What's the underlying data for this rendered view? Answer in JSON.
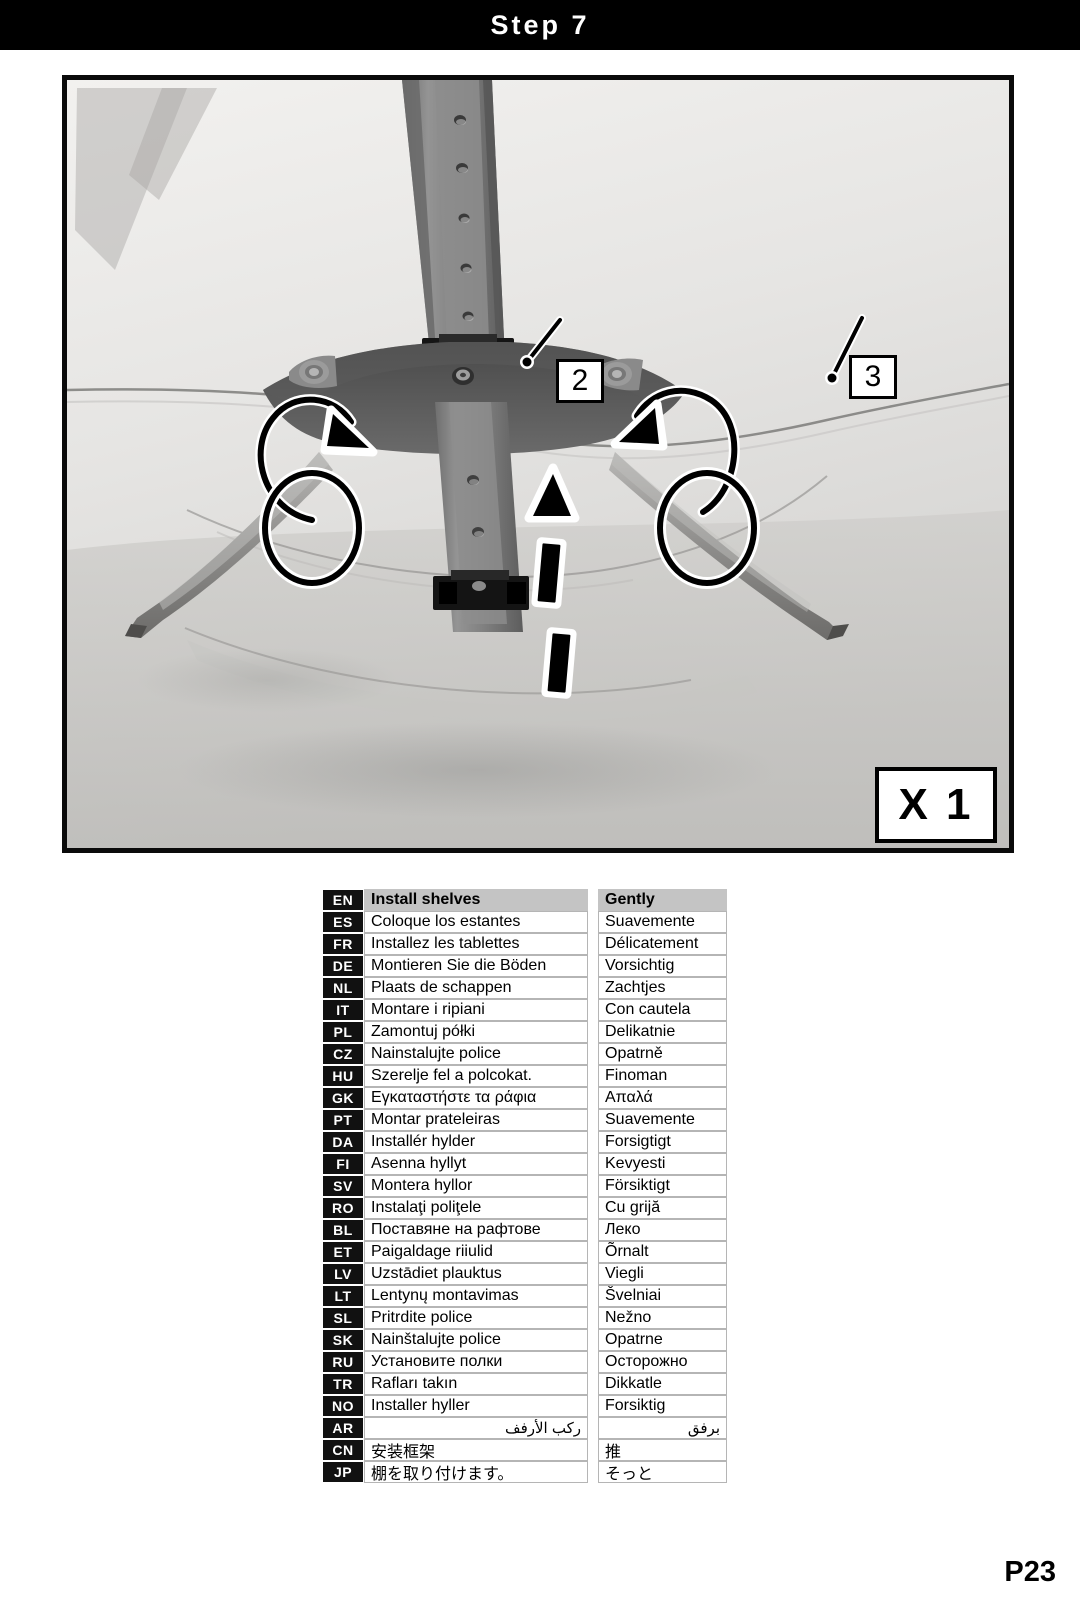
{
  "header": {
    "step_title": "Step 7"
  },
  "photo": {
    "callouts": [
      {
        "id": "2",
        "label": "2"
      },
      {
        "id": "3",
        "label": "3"
      }
    ],
    "quantity_label": "X 1",
    "annotations": {
      "left_curved_arrow": "curved-arrow-icon",
      "right_curved_arrow": "curved-arrow-icon",
      "left_highlight_circle": "highlight-circle-icon",
      "right_highlight_circle": "highlight-circle-icon",
      "dashed_up_arrow": "dashed-arrow-up-icon"
    }
  },
  "table": {
    "columns": [
      "code",
      "instruction",
      "manner"
    ],
    "rows": [
      {
        "code": "EN",
        "col1": "Install shelves",
        "col2": "Gently",
        "header": true
      },
      {
        "code": "ES",
        "col1": "Coloque los estantes",
        "col2": "Suavemente"
      },
      {
        "code": "FR",
        "col1": "Installez les tablettes",
        "col2": "Délicatement"
      },
      {
        "code": "DE",
        "col1": "Montieren Sie die Böden",
        "col2": "Vorsichtig"
      },
      {
        "code": "NL",
        "col1": "Plaats de schappen",
        "col2": "Zachtjes"
      },
      {
        "code": "IT",
        "col1": "Montare i ripiani",
        "col2": "Con cautela"
      },
      {
        "code": "PL",
        "col1": "Zamontuj półki",
        "col2": "Delikatnie"
      },
      {
        "code": "CZ",
        "col1": "Nainstalujte police",
        "col2": "Opatrně"
      },
      {
        "code": "HU",
        "col1": "Szerelje fel a polcokat.",
        "col2": "Finoman"
      },
      {
        "code": "GK",
        "col1": "Εγκαταστήστε τα ράφια",
        "col2": "Απαλά"
      },
      {
        "code": "PT",
        "col1": "Montar prateleiras",
        "col2": "Suavemente"
      },
      {
        "code": "DA",
        "col1": "Installér hylder",
        "col2": "Forsigtigt"
      },
      {
        "code": "FI",
        "col1": "Asenna hyllyt",
        "col2": "Kevyesti"
      },
      {
        "code": "SV",
        "col1": "Montera hyllor",
        "col2": "Försiktigt"
      },
      {
        "code": "RO",
        "col1": "Instalaţi poliţele",
        "col2": "Cu grijă"
      },
      {
        "code": "BL",
        "col1": "Поставяне на рафтове",
        "col2": "Леко"
      },
      {
        "code": "ET",
        "col1": "Paigaldage riiulid",
        "col2": "Õrnalt"
      },
      {
        "code": "LV",
        "col1": "Uzstādiet plauktus",
        "col2": "Viegli"
      },
      {
        "code": "LT",
        "col1": "Lentynų montavimas",
        "col2": "Švelniai"
      },
      {
        "code": "SL",
        "col1": "Pritrdite police",
        "col2": "Nežno"
      },
      {
        "code": "SK",
        "col1": "Nainštalujte police",
        "col2": "Opatrne"
      },
      {
        "code": "RU",
        "col1": "Установите полки",
        "col2": "Осторожно"
      },
      {
        "code": "TR",
        "col1": "Rafları takın",
        "col2": "Dikkatle"
      },
      {
        "code": "NO",
        "col1": "Installer hyller",
        "col2": "Forsiktig"
      },
      {
        "code": "AR",
        "col1": "ركب الأرفف",
        "col2": "برفق",
        "rtl": true
      },
      {
        "code": "CN",
        "col1": "安装框架",
        "col2": "推",
        "cjk": true
      },
      {
        "code": "JP",
        "col1": "棚を取り付けます。",
        "col2": "そっと",
        "cjk": true
      }
    ]
  },
  "footer": {
    "page_number": "P23"
  },
  "colors": {
    "header_bg": "#000000",
    "header_text": "#ffffff",
    "table_header_bg": "#c4c4c4",
    "code_bg": "#111111",
    "border": "#b5b5b5"
  }
}
